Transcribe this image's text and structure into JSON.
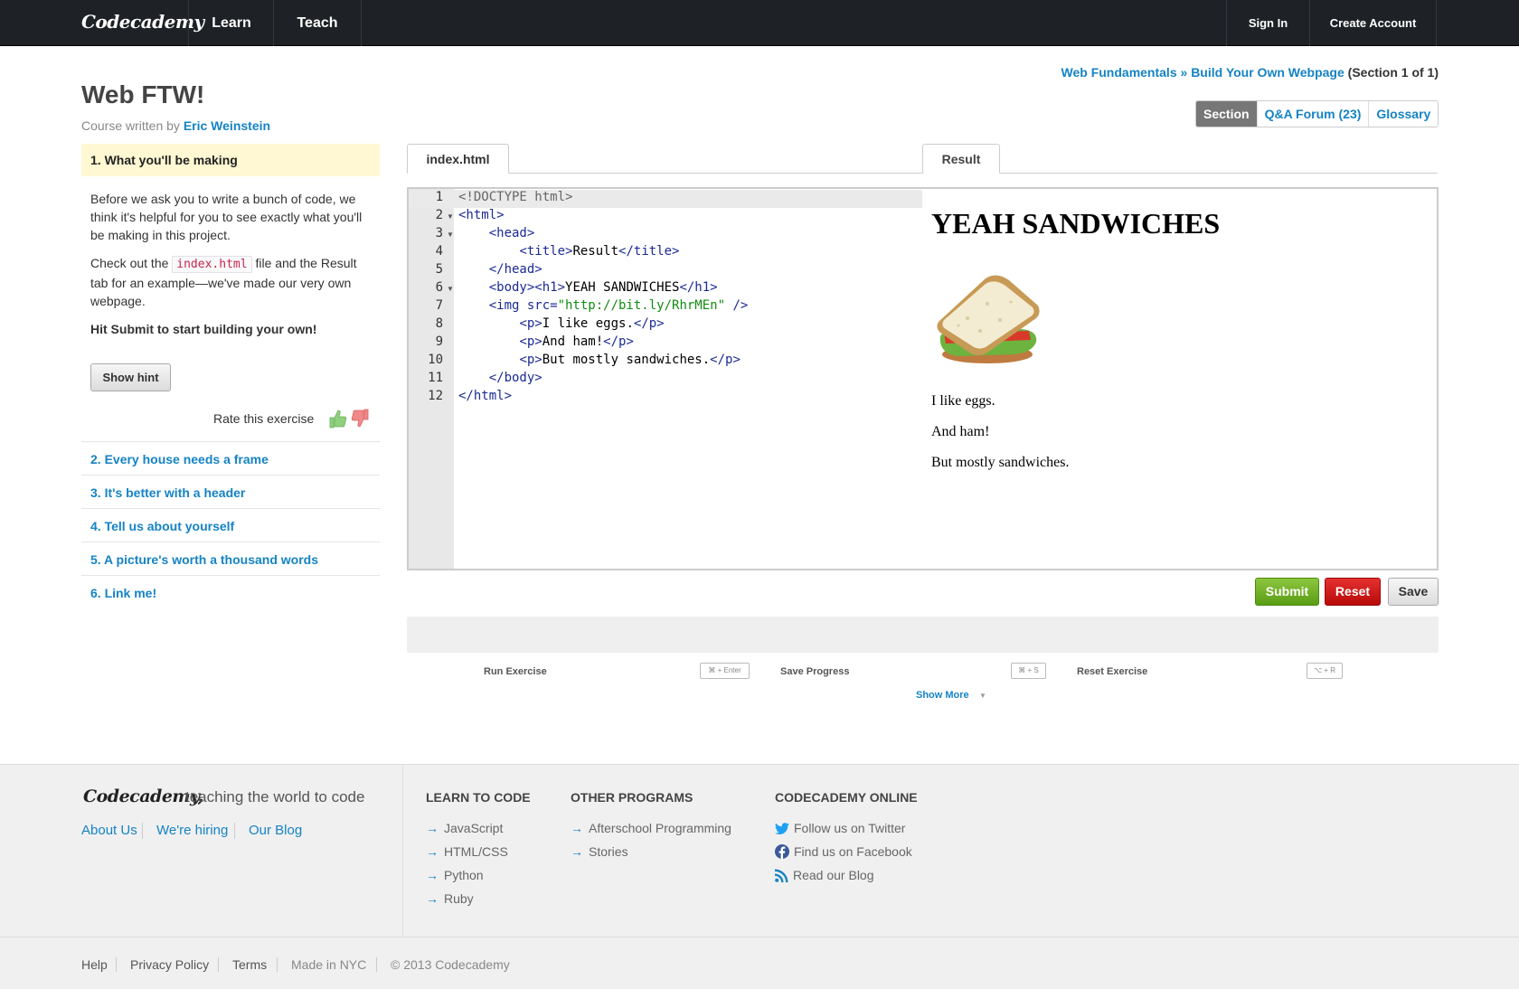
{
  "nav": {
    "logo": "Codecademy",
    "learn": "Learn",
    "teach": "Teach",
    "sign_in": "Sign In",
    "create_account": "Create Account"
  },
  "breadcrumb": {
    "course": "Web Fundamentals",
    "sep": " » ",
    "project": "Build Your Own Webpage",
    "section": " (Section 1 of 1)"
  },
  "course": {
    "title": "Web FTW!",
    "author_prefix": "Course written by ",
    "author": "Eric Weinstein"
  },
  "section_tabs": {
    "section": "Section",
    "forum": "Q&A Forum (23)",
    "glossary": "Glossary"
  },
  "lesson": {
    "active_title": "1. What you'll be making",
    "para1": "Before we ask you to write a bunch of code, we think it's helpful for you to see exactly what you'll be making in this project.",
    "para2_a": "Check out the ",
    "para2_code": "index.html",
    "para2_b": " file and the Result tab for an example—we've made our very own webpage.",
    "para3": "Hit Submit to start building your own!",
    "hint_button": "Show hint",
    "rate_label": "Rate this exercise",
    "links": [
      "2. Every house needs a frame",
      "3. It's better with a header",
      "4. Tell us about yourself",
      "5. A picture's worth a thousand words",
      "6. Link me!"
    ]
  },
  "editor": {
    "file_tab": "index.html",
    "result_tab": "Result",
    "line_numbers": [
      "1",
      "2",
      "3",
      "4",
      "5",
      "6",
      "7",
      "8",
      "9",
      "10",
      "11",
      "12"
    ],
    "lines": [
      "<!DOCTYPE html>",
      "<html>",
      "    <head>",
      "        <title>Result</title>",
      "    </head>",
      "    <body><h1>YEAH SANDWICHES</h1>",
      "    <img src=\"http://bit.ly/RhrMEn\" />",
      "        <p>I like eggs.</p>",
      "        <p>And ham!</p>",
      "        <p>But mostly sandwiches.</p>",
      "    </body>",
      "</html>"
    ]
  },
  "result": {
    "heading": "YEAH SANDWICHES",
    "paragraphs": [
      "I like eggs.",
      "And ham!",
      "But mostly sandwiches."
    ]
  },
  "actions": {
    "submit": "Submit",
    "reset": "Reset",
    "save": "Save"
  },
  "shortcuts": {
    "run": "Run Exercise",
    "run_key": "⌘ + Enter",
    "save": "Save Progress",
    "save_key": "⌘ + S",
    "reset": "Reset Exercise",
    "reset_key": "⌥ + R",
    "show_more": "Show More"
  },
  "footer": {
    "logo": "Codecademy,",
    "tagline": "teaching the world to code",
    "links": [
      "About Us",
      "We're hiring",
      "Our Blog"
    ],
    "learn_heading": "LEARN TO CODE",
    "learn_items": [
      "JavaScript",
      "HTML/CSS",
      "Python",
      "Ruby"
    ],
    "programs_heading": "OTHER PROGRAMS",
    "programs_items": [
      "Afterschool Programming",
      "Stories"
    ],
    "online_heading": "CODECADEMY ONLINE",
    "online_items": [
      "Follow us on Twitter",
      "Find us on Facebook",
      "Read our Blog"
    ],
    "bottom": [
      "Help",
      "Privacy Policy",
      "Terms",
      "Made in NYC",
      "© 2013 Codecademy"
    ]
  },
  "colors": {
    "link": "#1583c5",
    "nav_bg": "#1e2126",
    "submit": "#5a9d14",
    "reset": "#b80a0a",
    "tag": "#1b2a94",
    "string": "#118c11"
  },
  "icons": [
    "thumbs-up-icon",
    "thumbs-down-icon",
    "sandwich-image",
    "twitter-icon",
    "facebook-icon",
    "rss-icon"
  ]
}
